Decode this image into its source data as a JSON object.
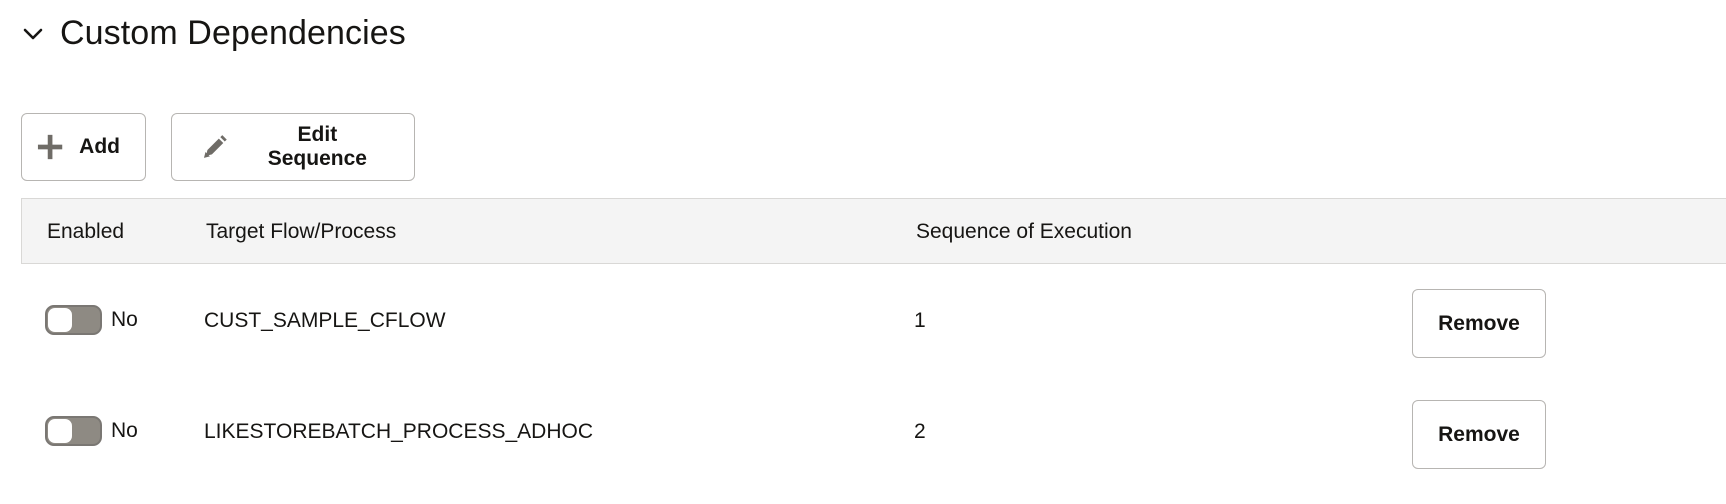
{
  "section": {
    "title": "Custom Dependencies",
    "chevron_icon": "chevron-down-icon"
  },
  "toolbar": {
    "add_label": "Add",
    "add_icon": "plus-icon",
    "edit_label": "Edit Sequence",
    "edit_icon": "pencil-icon"
  },
  "table": {
    "columns": [
      "Enabled",
      "Target Flow/Process",
      "Sequence of Execution"
    ],
    "rows": [
      {
        "enabled": false,
        "enabled_label": "No",
        "target": "CUST_SAMPLE_CFLOW",
        "sequence": "1",
        "action_label": "Remove"
      },
      {
        "enabled": false,
        "enabled_label": "No",
        "target": "LIKESTOREBATCH_PROCESS_ADHOC",
        "sequence": "2",
        "action_label": "Remove"
      }
    ]
  },
  "colors": {
    "toggle_off": "#8e8a83",
    "header_bg": "#f4f4f4",
    "border": "#b7b5b2",
    "icon_gray": "#6f6c67"
  }
}
